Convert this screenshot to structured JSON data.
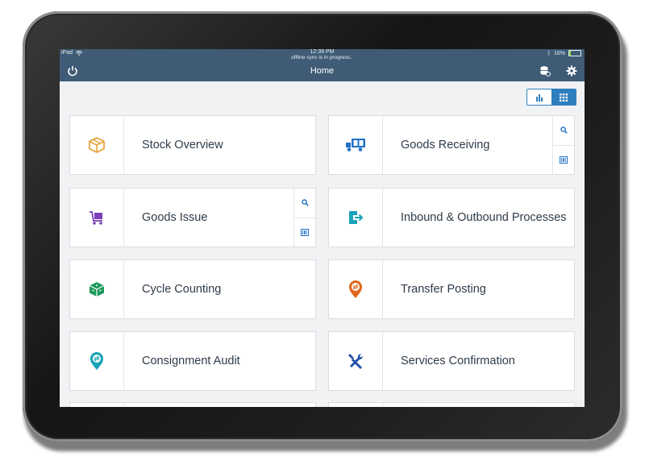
{
  "status": {
    "device": "iPad",
    "time": "12:39 PM",
    "sync": "offline sync is in progress..",
    "battery_text": "16%",
    "battery_level": 0.16
  },
  "nav": {
    "title": "Home",
    "power_icon": "power-icon",
    "database_icon": "database-sync-icon",
    "settings_icon": "gear-icon"
  },
  "view_toggle": {
    "chart_icon": "bar-chart-icon",
    "grid_icon": "grid-icon",
    "active": "grid"
  },
  "tiles": [
    {
      "label": "Stock Overview",
      "icon": "box-icon",
      "color": "#e8a33a"
    },
    {
      "label": "Goods Receiving",
      "icon": "delivery-truck-icon",
      "color": "#1f6fc4",
      "actions": [
        "search-icon",
        "barcode-icon"
      ]
    },
    {
      "label": "Goods Issue",
      "icon": "cart-icon",
      "color": "#7b3fb8",
      "actions": [
        "search-icon",
        "barcode-icon"
      ]
    },
    {
      "label": "Inbound & Outbound Processes",
      "icon": "inbound-outbound-icon",
      "color": "#17a3b8"
    },
    {
      "label": "Cycle Counting",
      "icon": "cube-count-icon",
      "color": "#1d9a5a"
    },
    {
      "label": "Transfer Posting",
      "icon": "transfer-pin-icon",
      "color": "#e0661c"
    },
    {
      "label": "Consignment Audit",
      "icon": "consignment-pin-icon",
      "color": "#17a3b8"
    },
    {
      "label": "Services Confirmation",
      "icon": "tools-icon",
      "color": "#1f4fa8"
    }
  ],
  "colors": {
    "header": "#3f5b76",
    "accent": "#2f7fbf",
    "background": "#f1f2f4"
  }
}
